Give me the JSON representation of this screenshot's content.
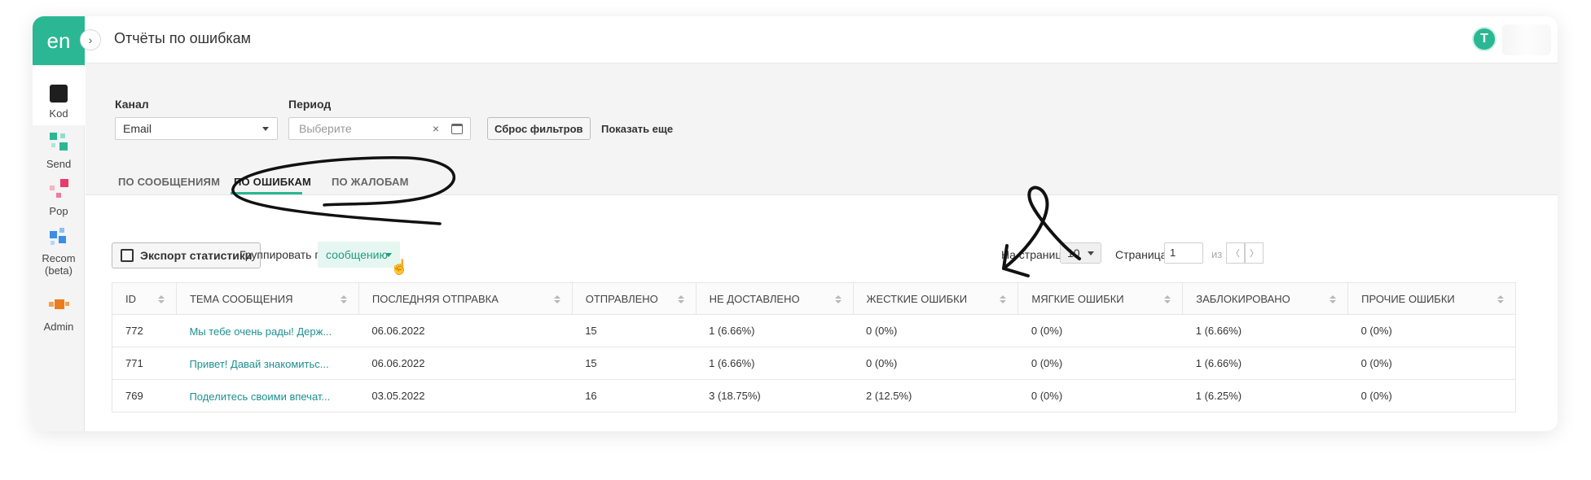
{
  "logo": "en",
  "sidebar": {
    "items": [
      {
        "label": "Kod",
        "icon": "kod-icon"
      },
      {
        "label": "Send",
        "icon": "send-icon"
      },
      {
        "label": "Pop",
        "icon": "pop-icon"
      },
      {
        "label": "Recom (beta)",
        "icon": "recom-icon"
      },
      {
        "label": "Admin",
        "icon": "admin-icon"
      }
    ]
  },
  "header": {
    "title": "Отчёты по ошибкам",
    "avatar_letter": "T"
  },
  "filters": {
    "channel_label": "Канал",
    "channel_value": "Email",
    "period_label": "Период",
    "period_placeholder": "Выберите",
    "clear_symbol": "×",
    "reset_label": "Сброс фильтров",
    "more_label": "Показать еще"
  },
  "tabs": [
    {
      "label": "ПО СООБЩЕНИЯМ",
      "active": false
    },
    {
      "label": "ПО ОШИБКАМ",
      "active": true
    },
    {
      "label": "ПО ЖАЛОБАМ",
      "active": false
    }
  ],
  "toolbar": {
    "export_label": "Экспорт статистики",
    "group_label": "Группировать по",
    "group_value": "сообщению",
    "per_page_label": "На странице",
    "per_page_value": "10",
    "page_label": "Страница",
    "page_value": "1",
    "of_label": "из 1",
    "prev_symbol": "〈",
    "next_symbol": "〉"
  },
  "table": {
    "columns": [
      "ID",
      "ТЕМА СООБЩЕНИЯ",
      "ПОСЛЕДНЯЯ ОТПРАВКА",
      "ОТПРАВЛЕНО",
      "НЕ ДОСТАВЛЕНО",
      "ЖЕСТКИЕ ОШИБКИ",
      "МЯГКИЕ ОШИБКИ",
      "ЗАБЛОКИРОВАНО",
      "ПРОЧИЕ ОШИБКИ"
    ],
    "rows": [
      [
        "772",
        "Мы тебе очень рады! Держ...",
        "06.06.2022",
        "15",
        "1 (6.66%)",
        "0 (0%)",
        "0 (0%)",
        "1 (6.66%)",
        "0 (0%)"
      ],
      [
        "771",
        "Привет! Давай знакомитьс...",
        "06.06.2022",
        "15",
        "1 (6.66%)",
        "0 (0%)",
        "0 (0%)",
        "1 (6.66%)",
        "0 (0%)"
      ],
      [
        "769",
        "Поделитесь своими впечат...",
        "03.05.2022",
        "16",
        "3 (18.75%)",
        "2 (12.5%)",
        "0 (0%)",
        "1 (6.25%)",
        "0 (0%)"
      ]
    ]
  },
  "colors": {
    "brand": "#2bb793",
    "link": "#1f8f90"
  }
}
